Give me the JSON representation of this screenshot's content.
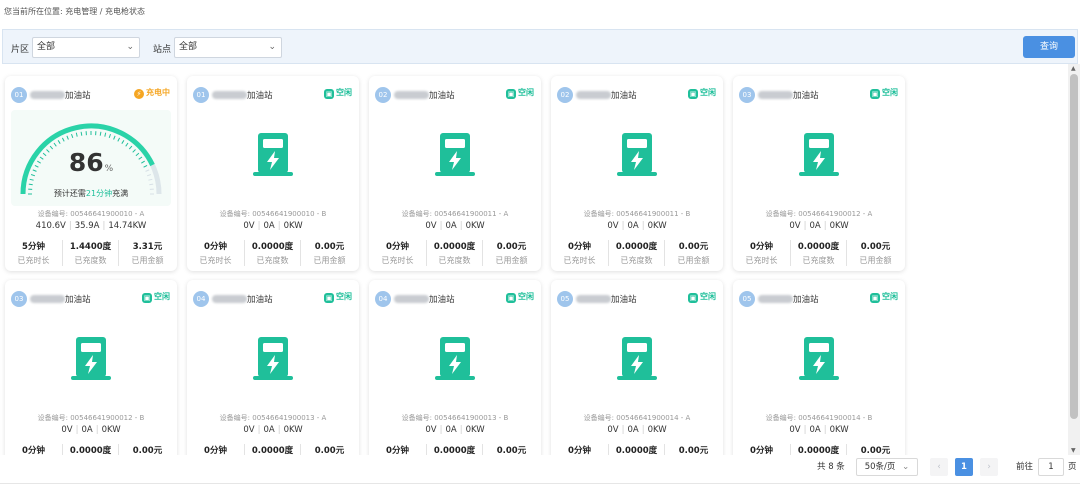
{
  "breadcrumb": "您当前所在位置: 充电管理 / 充电枪状态",
  "filters": {
    "area_label": "片区",
    "area_value": "全部",
    "station_label": "站点",
    "station_value": "全部",
    "query_button": "查询"
  },
  "labels": {
    "device_prefix": "设备编号: ",
    "duration": "已充时长",
    "energy": "已充度数",
    "amount": "已用金额",
    "remaining_prefix": "预计还需",
    "remaining_suffix": "充满",
    "percent_unit": "%"
  },
  "colors": {
    "accent": "#1fbf9a",
    "charging": "#f5a623",
    "primary": "#4a90e2"
  },
  "cards": [
    {
      "num": "01",
      "name": "加油站",
      "status": "充电中",
      "state": "charging",
      "device": "00546641900010 - A",
      "voltage": "410.6V",
      "current": "35.9A",
      "power": "14.74KW",
      "duration": "5分钟",
      "energy": "1.4400度",
      "amount": "3.31元",
      "percent": "86",
      "percent_value": 0.86,
      "remaining": "21分钟"
    },
    {
      "num": "01",
      "name": "加油站",
      "status": "空闲",
      "state": "idle",
      "device": "00546641900010 - B",
      "voltage": "0V",
      "current": "0A",
      "power": "0KW",
      "duration": "0分钟",
      "energy": "0.0000度",
      "amount": "0.00元"
    },
    {
      "num": "02",
      "name": "加油站",
      "status": "空闲",
      "state": "idle",
      "device": "00546641900011 - A",
      "voltage": "0V",
      "current": "0A",
      "power": "0KW",
      "duration": "0分钟",
      "energy": "0.0000度",
      "amount": "0.00元"
    },
    {
      "num": "02",
      "name": "加油站",
      "status": "空闲",
      "state": "idle",
      "device": "00546641900011 - B",
      "voltage": "0V",
      "current": "0A",
      "power": "0KW",
      "duration": "0分钟",
      "energy": "0.0000度",
      "amount": "0.00元"
    },
    {
      "num": "03",
      "name": "加油站",
      "status": "空闲",
      "state": "idle",
      "device": "00546641900012 - A",
      "voltage": "0V",
      "current": "0A",
      "power": "0KW",
      "duration": "0分钟",
      "energy": "0.0000度",
      "amount": "0.00元"
    },
    {
      "num": "03",
      "name": "加油站",
      "status": "空闲",
      "state": "idle",
      "device": "00546641900012 - B",
      "voltage": "0V",
      "current": "0A",
      "power": "0KW",
      "duration": "0分钟",
      "energy": "0.0000度",
      "amount": "0.00元"
    },
    {
      "num": "04",
      "name": "加油站",
      "status": "空闲",
      "state": "idle",
      "device": "00546641900013 - A",
      "voltage": "0V",
      "current": "0A",
      "power": "0KW",
      "duration": "0分钟",
      "energy": "0.0000度",
      "amount": "0.00元"
    },
    {
      "num": "04",
      "name": "加油站",
      "status": "空闲",
      "state": "idle",
      "device": "00546641900013 - B",
      "voltage": "0V",
      "current": "0A",
      "power": "0KW",
      "duration": "0分钟",
      "energy": "0.0000度",
      "amount": "0.00元"
    },
    {
      "num": "05",
      "name": "加油站",
      "status": "空闲",
      "state": "idle",
      "device": "00546641900014 - A",
      "voltage": "0V",
      "current": "0A",
      "power": "0KW",
      "duration": "0分钟",
      "energy": "0.0000度",
      "amount": "0.00元"
    },
    {
      "num": "05",
      "name": "加油站",
      "status": "空闲",
      "state": "idle",
      "device": "00546641900014 - B",
      "voltage": "0V",
      "current": "0A",
      "power": "0KW",
      "duration": "0分钟",
      "energy": "0.0000度",
      "amount": "0.00元"
    }
  ],
  "pagination": {
    "total": "共 8 条",
    "page_size": "50条/页",
    "prev": "‹",
    "current": "1",
    "next": "›",
    "goto_label": "前往",
    "goto_value": "1",
    "page_suffix": "页"
  }
}
